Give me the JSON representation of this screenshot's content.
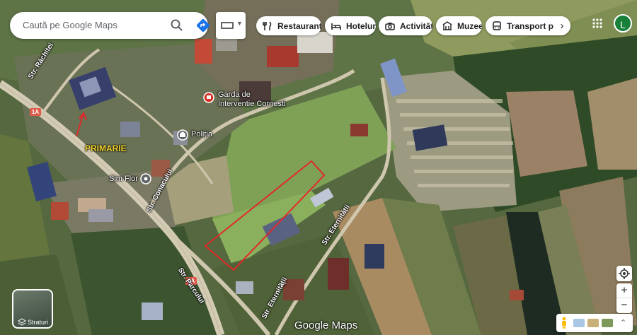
{
  "search": {
    "placeholder": "Caută pe Google Maps"
  },
  "chips": [
    {
      "label": "Restaurante",
      "icon": "fork-knife-icon"
    },
    {
      "label": "Hoteluri",
      "icon": "bed-icon"
    },
    {
      "label": "Activități",
      "icon": "camera-icon"
    },
    {
      "label": "Muzee",
      "icon": "museum-icon"
    },
    {
      "label": "Transport publi",
      "icon": "bus-icon"
    }
  ],
  "user": {
    "initial": "L",
    "avatar_color": "#188038"
  },
  "map": {
    "poi": [
      {
        "name": "Garda de Interventie Cornesti",
        "icon": "pin-icon",
        "color": "#d93025"
      },
      {
        "name": "Poliția",
        "icon": "police-icon",
        "color": "#5f6368"
      },
      {
        "name": "Sim Flor",
        "icon": "shop-pin-icon",
        "color": "#5f6368"
      }
    ],
    "streets": [
      "Str. Răchitei",
      "Str. Conacului",
      "Str. Parcului",
      "Str. Eternității",
      "Str. Eternității"
    ],
    "road_shields": [
      "1A",
      "1A"
    ],
    "annotation": {
      "text": "PRIMARIE",
      "color": "#f2d32c",
      "outline_color": "#d33"
    }
  },
  "controls": {
    "layers_label": "Straturi",
    "logo": "Google Maps",
    "zoom_in": "+",
    "zoom_out": "−"
  }
}
